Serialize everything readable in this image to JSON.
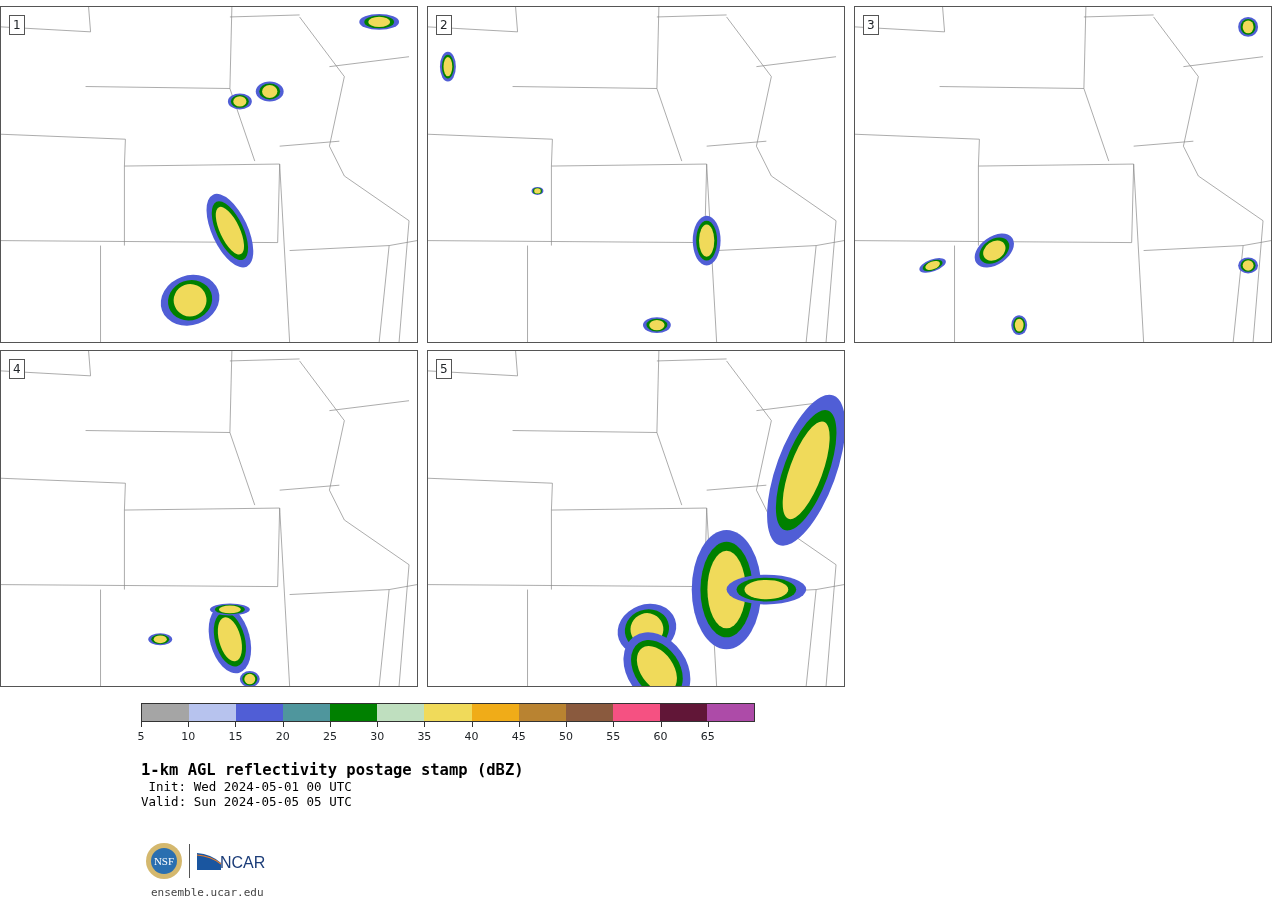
{
  "panels": [
    {
      "label": "1"
    },
    {
      "label": "2"
    },
    {
      "label": "3"
    },
    {
      "label": "4"
    },
    {
      "label": "5"
    }
  ],
  "colorbar": {
    "segments": [
      {
        "color": "#a5a5a5"
      },
      {
        "color": "#b7c3ee"
      },
      {
        "color": "#505ed6"
      },
      {
        "color": "#4f969d"
      },
      {
        "color": "#008000"
      },
      {
        "color": "#bfdfbf"
      },
      {
        "color": "#f0da5a"
      },
      {
        "color": "#f0ac18"
      },
      {
        "color": "#b98331"
      },
      {
        "color": "#8a5a3e"
      },
      {
        "color": "#f55182"
      },
      {
        "color": "#611637"
      },
      {
        "color": "#ad4ba8"
      }
    ],
    "ticks": [
      "5",
      "10",
      "15",
      "20",
      "25",
      "30",
      "35",
      "40",
      "45",
      "50",
      "55",
      "60",
      "65"
    ]
  },
  "title": "1-km AGL reflectivity postage stamp (dBZ)",
  "init": "Init: Wed 2024-05-01 00 UTC",
  "valid": "Valid: Sun 2024-05-05 05 UTC",
  "logos": {
    "nsf": "NSF",
    "ncar": "NCAR"
  },
  "footer_link": "ensemble.ucar.edu"
}
